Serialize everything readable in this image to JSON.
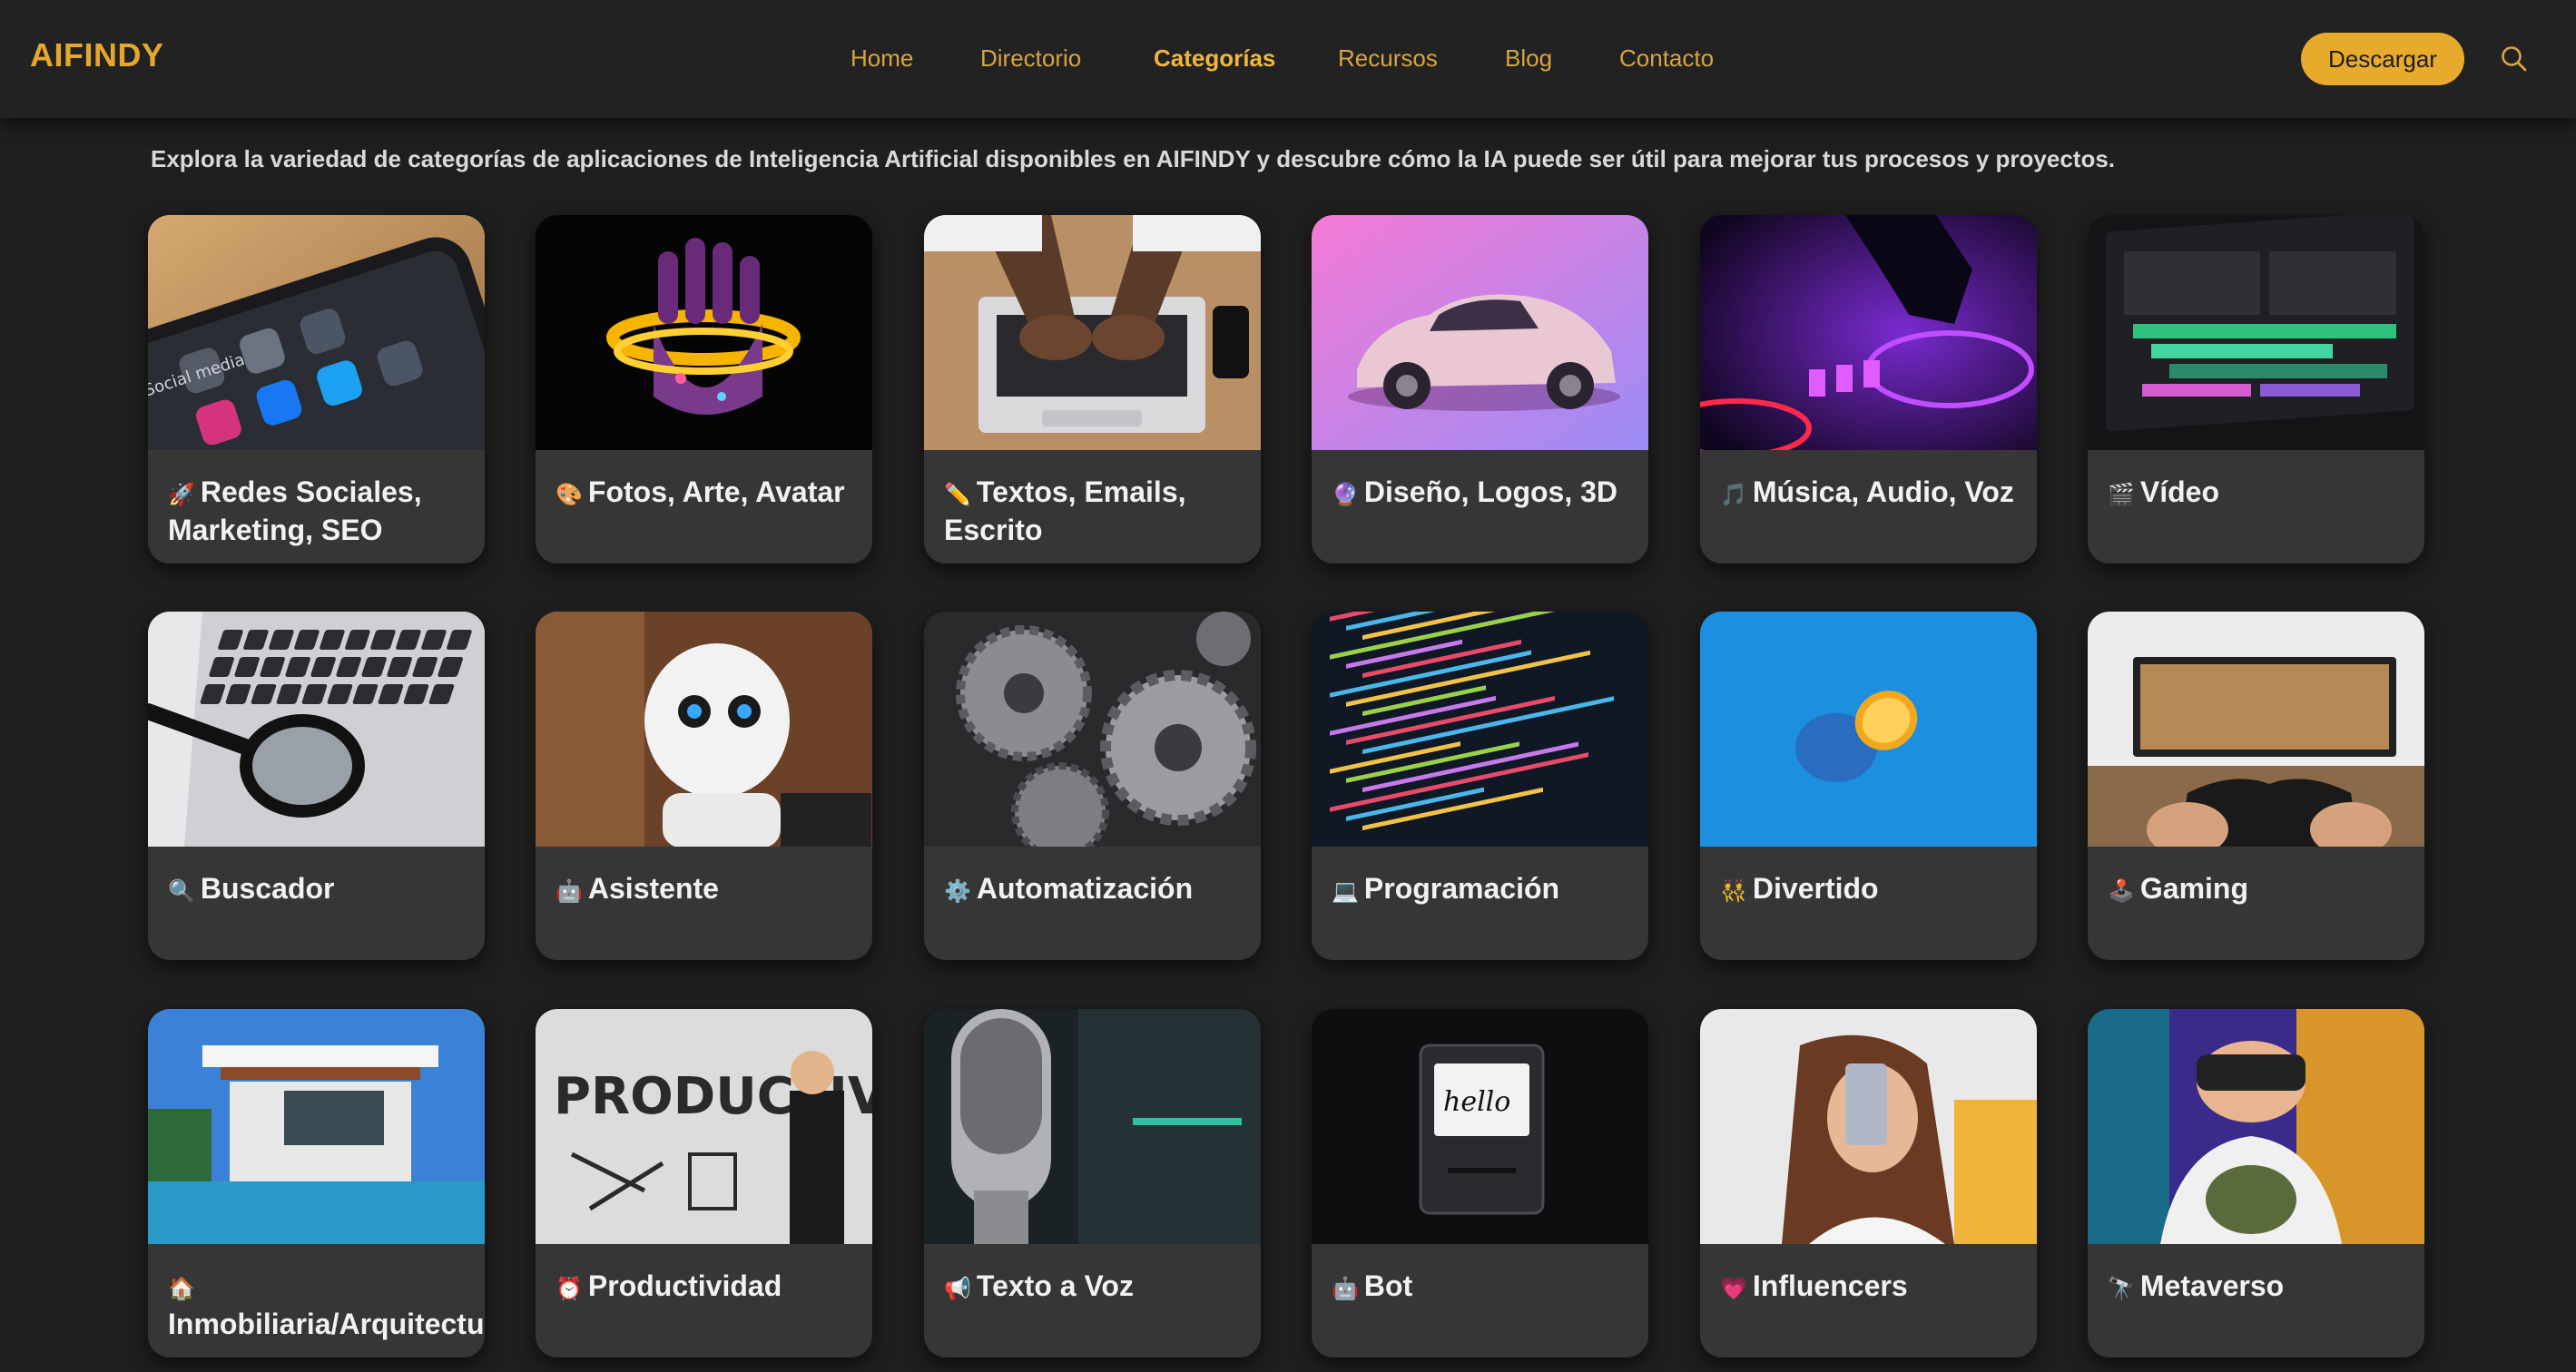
{
  "header": {
    "logo": "AIFINDY",
    "nav": [
      {
        "label": "Home"
      },
      {
        "label": "Directorio"
      },
      {
        "label": "Categorías"
      },
      {
        "label": "Recursos"
      },
      {
        "label": "Blog"
      },
      {
        "label": "Contacto"
      }
    ],
    "active_nav": "Categorías",
    "download_label": "Descargar",
    "search_icon": "search-icon"
  },
  "intro": {
    "text": "Explora la variedad de categorías de aplicaciones de Inteligencia Artificial disponibles en AIFINDY y descubre cómo la IA puede ser útil para mejorar tus procesos y proyectos."
  },
  "colors": {
    "accent": "#e8aa2c",
    "background": "#1f1f1f",
    "card": "#363636"
  },
  "categories": [
    {
      "emoji": "🚀",
      "label": "Redes Sociales, Marketing, SEO",
      "image": "phone-social-apps"
    },
    {
      "emoji": "🎨",
      "label": "Fotos, Arte, Avatar",
      "image": "glowing-hand"
    },
    {
      "emoji": "✏️",
      "label": "Textos, Emails, Escrito",
      "image": "laptop-typing"
    },
    {
      "emoji": "🔮",
      "label": "Diseño, Logos, 3D",
      "image": "pink-car"
    },
    {
      "emoji": "🎵",
      "label": "Música, Audio, Voz",
      "image": "dj-mixer"
    },
    {
      "emoji": "🎬",
      "label": "Vídeo",
      "image": "video-editor"
    },
    {
      "emoji": "🔍",
      "label": "Buscador",
      "image": "magnifier-keyboard"
    },
    {
      "emoji": "🤖",
      "label": "Asistente",
      "image": "robot"
    },
    {
      "emoji": "⚙️",
      "label": "Automatización",
      "image": "gears"
    },
    {
      "emoji": "💻",
      "label": "Programación",
      "image": "code-screen"
    },
    {
      "emoji": "👯",
      "label": "Divertido",
      "image": "blue-lemon"
    },
    {
      "emoji": "🕹️",
      "label": "Gaming",
      "image": "game-controller"
    },
    {
      "emoji": "🏠",
      "label": "Inmobiliaria/Arquitectura",
      "image": "modern-house"
    },
    {
      "emoji": "⏰",
      "label": "Productividad",
      "image": "productivity-wall"
    },
    {
      "emoji": "📢",
      "label": "Texto a Voz",
      "image": "microphone"
    },
    {
      "emoji": "🤖",
      "label": "Bot",
      "image": "retro-computer"
    },
    {
      "emoji": "💗",
      "label": "Influencers",
      "image": "selfie-girl"
    },
    {
      "emoji": "🔭",
      "label": "Metaverso",
      "image": "vr-headset"
    }
  ]
}
